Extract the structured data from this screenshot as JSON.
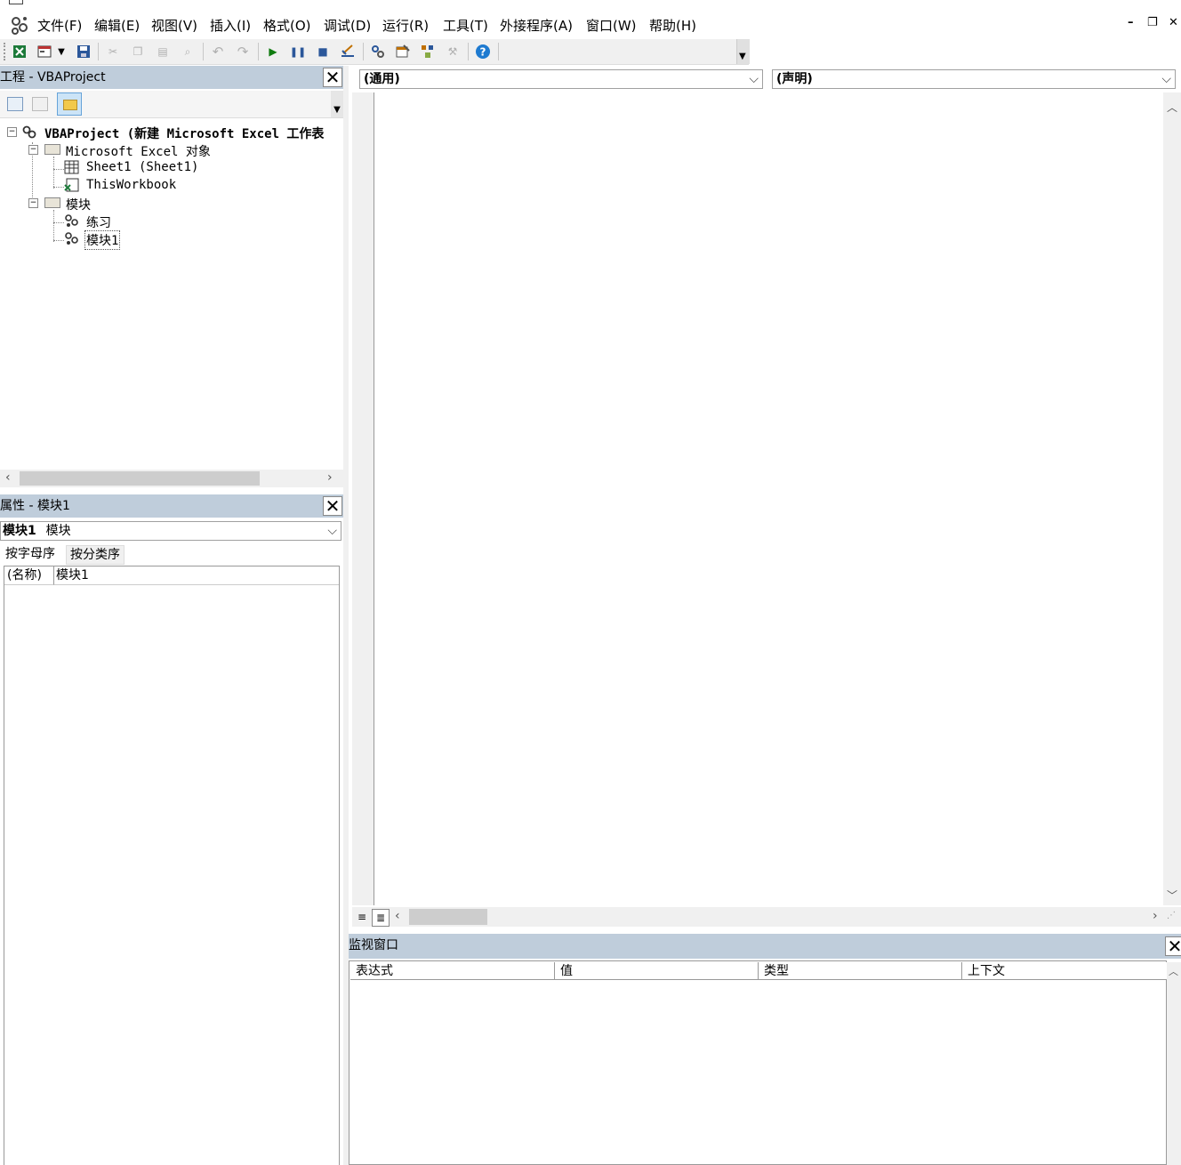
{
  "menubar": {
    "items": [
      "文件(F)",
      "编辑(E)",
      "视图(V)",
      "插入(I)",
      "格式(O)",
      "调试(D)",
      "运行(R)",
      "工具(T)",
      "外接程序(A)",
      "窗口(W)",
      "帮助(H)"
    ],
    "min_glyph": "–",
    "restore_glyph": "❐",
    "close_glyph": "✕"
  },
  "project_pane": {
    "title": "工程 - VBAProject",
    "tree": {
      "root": "VBAProject (新建 Microsoft Excel 工作表",
      "folder_objects": "Microsoft Excel 对象",
      "sheet1": "Sheet1 (Sheet1)",
      "thisworkbook": "ThisWorkbook",
      "folder_modules": "模块",
      "module_practice": "练习",
      "module1": "模块1"
    }
  },
  "properties_pane": {
    "title": "属性 - 模块1",
    "object_combo": {
      "name": "模块1",
      "type": "模块"
    },
    "tabs": [
      "按字母序",
      "按分类序"
    ],
    "rows": [
      {
        "name": "(名称)",
        "value": "模块1"
      }
    ]
  },
  "code_window": {
    "object_combo": "(通用)",
    "procedure_combo": "(声明)"
  },
  "watch_pane": {
    "title": "监视窗口",
    "columns": [
      "表达式",
      "值",
      "类型",
      "上下文"
    ]
  },
  "colors": {
    "pane_header": "#bfcddb",
    "toolbar_bg": "#f0f0f0",
    "help_blue": "#1e7ad0",
    "run_green": "#107c10",
    "excel_green": "#1d7a3a"
  }
}
